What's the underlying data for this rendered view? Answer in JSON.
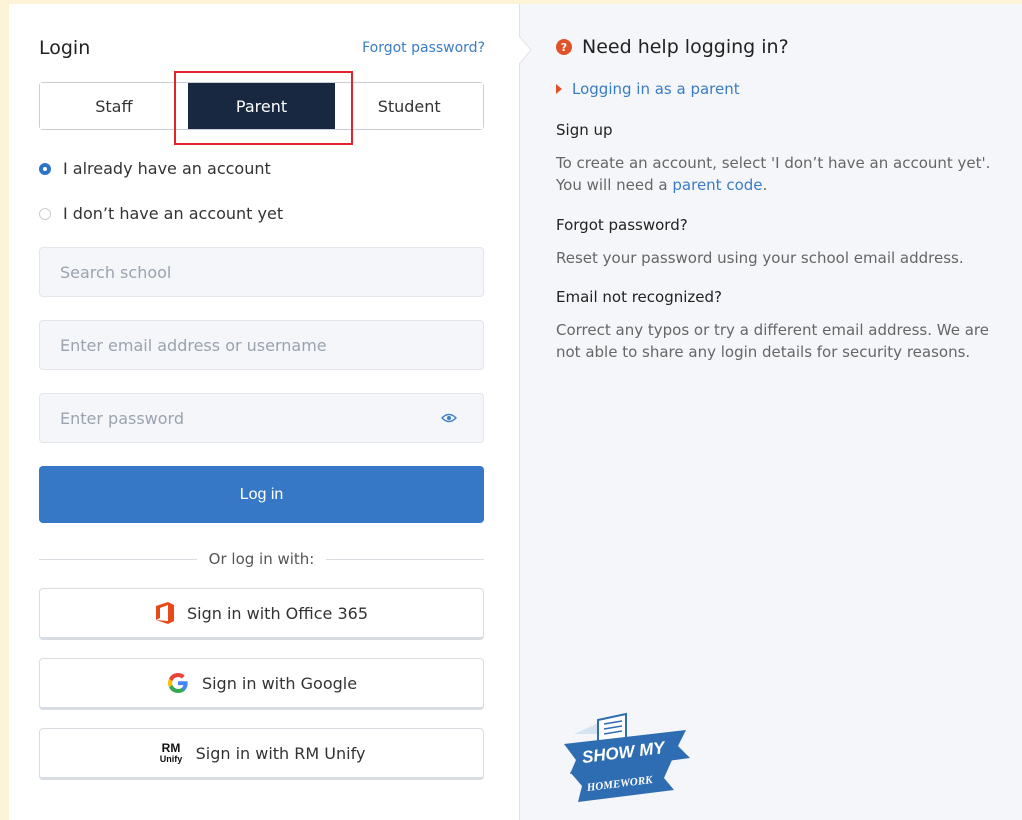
{
  "login": {
    "title": "Login",
    "forgot_link": "Forgot password?",
    "roles": [
      "Staff",
      "Parent",
      "Student"
    ],
    "active_role": "Parent",
    "account_options": [
      "I already have an account",
      "I don’t have an account yet"
    ],
    "selected_account_option": "I already have an account",
    "school_placeholder": "Search school",
    "email_placeholder": "Enter email address or username",
    "password_placeholder": "Enter password",
    "login_button": "Log in",
    "divider_text": "Or log in with:",
    "sso": {
      "office365": "Sign in with Office 365",
      "google": "Sign in with Google",
      "rm_unify": "Sign in with RM Unify"
    },
    "rm_logo_text": [
      "RM",
      "Unify"
    ]
  },
  "help": {
    "title": "Need help logging in?",
    "parent_link": "Logging in as a parent",
    "signup_heading": "Sign up",
    "signup_text": "To create an account, select 'I don’t have an account yet'. You will need a",
    "signup_link": "parent code",
    "signup_end": ".",
    "forgot_heading": "Forgot password?",
    "forgot_text": "Reset your password using your school email address.",
    "email_heading": "Email not recognized?",
    "email_text": "Correct any typos or try a different email address. We are not able to share any login details for security reasons.",
    "logo_text": [
      "SHOW MY",
      "HOMEWORK"
    ]
  },
  "colors": {
    "primary": "#3778c6",
    "active_tab": "#172840",
    "highlight": "#e0262b",
    "accent": "#e0532a"
  }
}
